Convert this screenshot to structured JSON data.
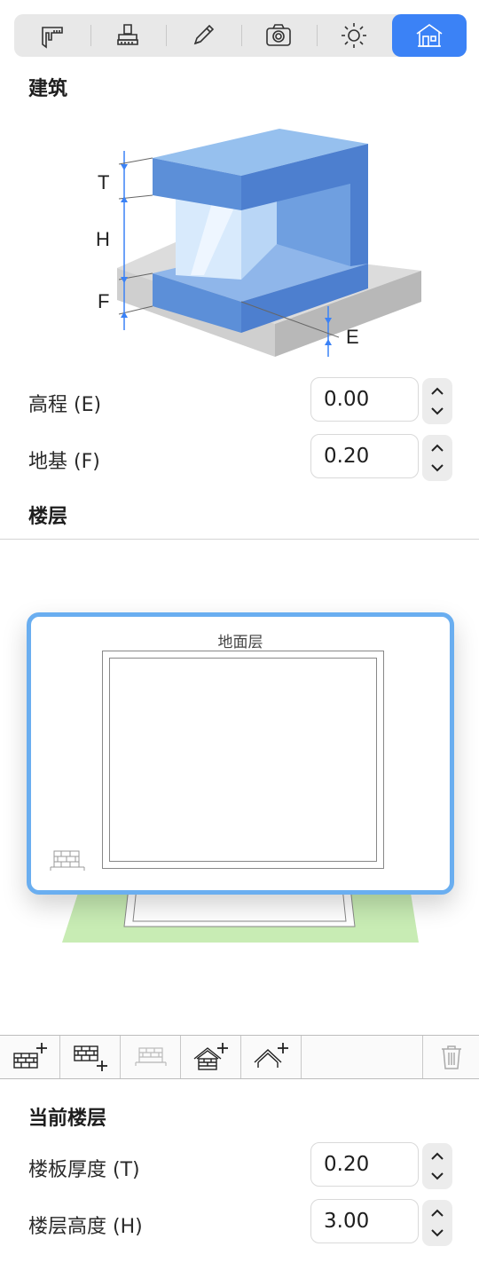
{
  "tabs": [
    {
      "icon": "calipers-icon"
    },
    {
      "icon": "stamp-icon"
    },
    {
      "icon": "pencil-icon"
    },
    {
      "icon": "camera-icon"
    },
    {
      "icon": "sun-icon"
    },
    {
      "icon": "building-icon",
      "active": true
    }
  ],
  "building": {
    "title": "建筑",
    "diagram_labels": {
      "t": "T",
      "h": "H",
      "f": "F",
      "e": "E"
    },
    "elevation": {
      "label": "高程 (E)",
      "value": "0.00"
    },
    "foundation": {
      "label": "地基 (F)",
      "value": "0.20"
    }
  },
  "floors": {
    "title": "楼层",
    "preview_floor_name": "地面层"
  },
  "toolbar": {
    "icons": [
      "add-floor-above-icon",
      "add-floor-below-icon",
      "floor-disabled-icon",
      "add-roof-floor-icon",
      "add-roof-icon",
      "trash-icon"
    ]
  },
  "current_floor": {
    "title": "当前楼层",
    "slab_thickness": {
      "label": "楼板厚度 (T)",
      "value": "0.20"
    },
    "floor_height": {
      "label": "楼层高度 (H)",
      "value": "3.00"
    }
  },
  "colors": {
    "accent": "#3b82f6",
    "selection": "#6aaef0",
    "floor_base": "#c8ecb4"
  }
}
